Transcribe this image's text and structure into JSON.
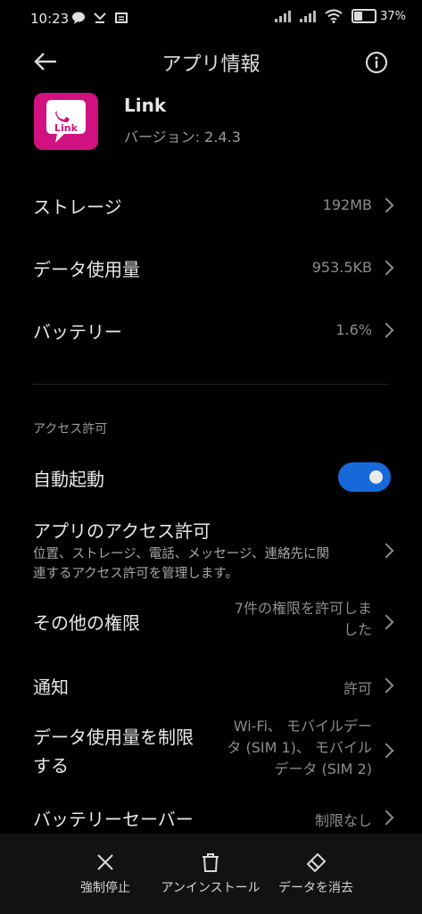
{
  "status": {
    "time": "10:23",
    "battery_text": "37%",
    "battery_level": 0.37
  },
  "header": {
    "title": "アプリ情報"
  },
  "app": {
    "name": "Link",
    "version": "バージョン: 2.4.3",
    "icon_text": "Link",
    "brand_color": "#d1117f"
  },
  "rows": {
    "storage": {
      "label": "ストレージ",
      "value": "192MB"
    },
    "data_usage": {
      "label": "データ使用量",
      "value": "953.5KB"
    },
    "battery": {
      "label": "バッテリー",
      "value": "1.6%"
    }
  },
  "section_title": "アクセス許可",
  "autostart": {
    "label": "自動起動",
    "enabled": true,
    "accent": "#1769d9"
  },
  "permissions": {
    "label": "アプリのアクセス許可",
    "desc_line1": "位置、ストレージ、電話、メッセージ、連絡先に関",
    "desc_line2": "連するアクセス許可を管理します。"
  },
  "other_perms": {
    "label": "その他の権限",
    "value_line1": "7件の権限を許可しま",
    "value_line2": "した"
  },
  "notifications": {
    "label": "通知",
    "value": "許可"
  },
  "restrict_data": {
    "label_line1": "データ使用量を制限",
    "label_line2": "する",
    "value_line1": "Wi-Fi、 モバイルデー",
    "value_line2": "タ (SIM 1)、 モバイル",
    "value_line3": "データ (SIM 2)"
  },
  "battery_saver": {
    "label": "バッテリーセーバー",
    "value": "制限なし"
  },
  "actions": {
    "force_stop": "強制停止",
    "uninstall": "アンインストール",
    "clear_data": "データを消去"
  }
}
